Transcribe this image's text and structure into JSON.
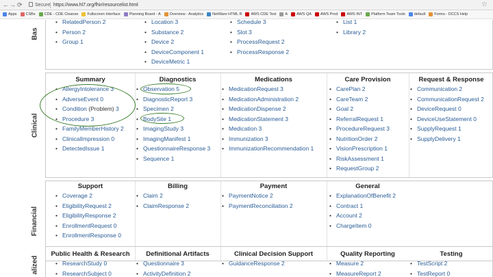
{
  "browser": {
    "secure_label": "Secure",
    "url": "https://www.hl7.org/fhir/resourcelist.html",
    "bookmarks": [
      {
        "label": "Apps",
        "color": "#4a86e8"
      },
      {
        "label": "CSBs",
        "color": "#e06666"
      },
      {
        "label": "CDE - CDE Cleanse",
        "color": "#6aa84f"
      },
      {
        "label": "Fullscreen Interface",
        "color": "#f1c232"
      },
      {
        "label": "Planning Board - A",
        "color": "#8e7cc3"
      },
      {
        "label": "Overview - Analytics",
        "color": "#e69138"
      },
      {
        "label": "NetWare HTML R",
        "color": "#3d85c6"
      },
      {
        "label": "AWS CDE Test",
        "color": "#cc0000"
      },
      {
        "label": "A",
        "color": "#999999"
      },
      {
        "label": "AWS QA",
        "color": "#cc0000"
      },
      {
        "label": "AWS Prod",
        "color": "#cc0000"
      },
      {
        "label": "AWS INT",
        "color": "#cc0000"
      },
      {
        "label": "Platform Team Tools",
        "color": "#6aa84f"
      },
      {
        "label": "default",
        "color": "#4a86e8"
      },
      {
        "label": "Forms - DCCS Help",
        "color": "#e69138"
      }
    ]
  },
  "base": {
    "side_label": "Bas",
    "columns": [
      [
        "RelatedPerson 2",
        "Person 2",
        "Group 1"
      ],
      [
        "Location 3",
        "Substance 2",
        "Device 2",
        "DeviceComponent 1",
        "DeviceMetric 1"
      ],
      [
        "Schedule 3",
        "Slot 3",
        "ProcessRequest 2",
        "ProcessResponse 2"
      ],
      [
        "List 1",
        "Library 2"
      ]
    ]
  },
  "clinical": {
    "side_label": "Clinical",
    "summary": {
      "title": "Summary",
      "items": [
        {
          "name": "AllergyIntolerance",
          "count": "3"
        },
        {
          "name": "AdverseEvent",
          "count": "0"
        },
        {
          "name": "Condition",
          "note": "(Problem)",
          "count": "3"
        },
        {
          "name": "Procedure",
          "count": "3"
        },
        {
          "name": "FamilyMemberHistory",
          "count": "2"
        },
        {
          "name": "ClinicalImpression",
          "count": "0"
        },
        {
          "name": "DetectedIssue",
          "count": "1"
        }
      ]
    },
    "diagnostics": {
      "title": "Diagnostics",
      "items": [
        "Observation 5",
        "DiagnosticReport 3",
        "Specimen 2",
        "BodySite 1",
        "ImagingStudy 3",
        "ImagingManifest 1",
        "QuestionnaireResponse 3",
        "Sequence 1"
      ]
    },
    "medications": {
      "title": "Medications",
      "items": [
        "MedicationRequest 3",
        "MedicationAdministration 2",
        "MedicationDispense 2",
        "MedicationStatement 3",
        "Medication 3",
        "Immunization 3",
        "ImmunizationRecommendation 1"
      ]
    },
    "care_provision": {
      "title": "Care Provision",
      "items": [
        "CarePlan 2",
        "CareTeam 2",
        "Goal 2",
        "ReferralRequest 1",
        "ProcedureRequest 3",
        "NutritionOrder 2",
        "VisionPrescription 1",
        "RiskAssessment 1",
        "RequestGroup 2"
      ]
    },
    "request_response": {
      "title": "Request & Response",
      "items": [
        "Communication 2",
        "CommunicationRequest 2",
        "DeviceRequest 0",
        "DeviceUseStatement 0",
        "SupplyRequest 1",
        "SupplyDelivery 1"
      ]
    }
  },
  "financial": {
    "side_label": "Financial",
    "support": {
      "title": "Support",
      "items": [
        "Coverage 2",
        "EligibilityRequest 2",
        "EligibilityResponse 2",
        "EnrollmentRequest 0",
        "EnrollmentResponse 0"
      ]
    },
    "billing": {
      "title": "Billing",
      "items": [
        "Claim 2",
        "ClaimResponse 2"
      ]
    },
    "payment": {
      "title": "Payment",
      "items": [
        "PaymentNotice 2",
        "PaymentReconciliation 2"
      ]
    },
    "general": {
      "title": "General",
      "items": [
        "ExplanationOfBenefit 2",
        "Contract 1",
        "Account 2",
        "ChargeItem 0"
      ]
    }
  },
  "specialized": {
    "side_label": "alized",
    "public_health": {
      "title": "Public Health & Research",
      "items": [
        "ResearchStudy 0",
        "ResearchSubject 0"
      ]
    },
    "definitional": {
      "title": "Definitional Artifacts",
      "items": [
        "Questionnaire 3",
        "ActivityDefinition 2"
      ]
    },
    "cds": {
      "title": "Clinical Decision Support",
      "items": [
        "GuidanceResponse 2"
      ]
    },
    "quality": {
      "title": "Quality Reporting",
      "items": [
        "Measure 2",
        "MeasureReport 2"
      ]
    },
    "testing": {
      "title": "Testing",
      "items": [
        "TestScript 2",
        "TestReport 0"
      ]
    }
  },
  "annotation": {
    "color": "#3a7d2b"
  }
}
